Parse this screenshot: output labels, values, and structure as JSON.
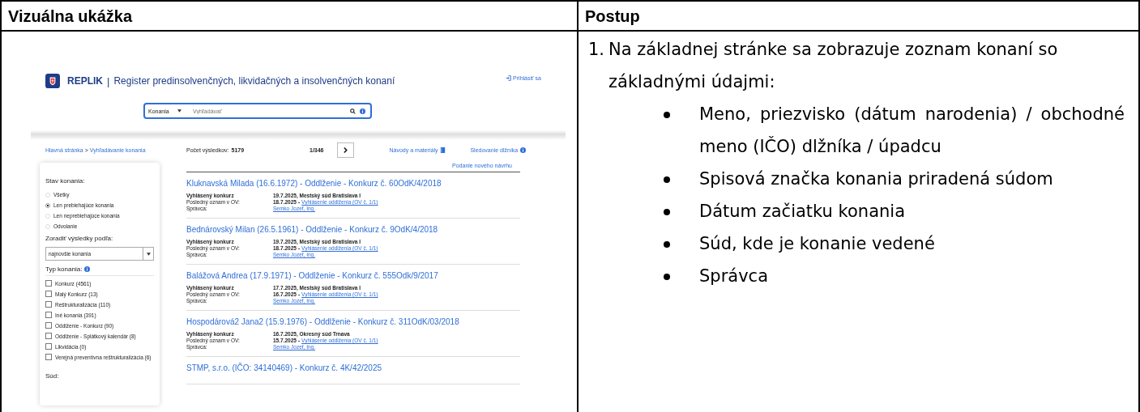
{
  "table": {
    "columns": [
      "Vizuálna ukážka",
      "Postup"
    ]
  },
  "screenshot": {
    "logo_text": "REPLIK",
    "title_separator": "|",
    "site_title": "Register predinsolvenčných, likvidačných a insolvenčných konaní",
    "login": "Prihlásiť sa",
    "search": {
      "category": "Konania",
      "placeholder": "Vyhľadávať"
    },
    "breadcrumb": [
      "Hlavná stránka",
      "Vyhľadávanie konania"
    ],
    "breadcrumb_separator": ">",
    "result_count_label": "Počet výsledkov:",
    "result_count": "5179",
    "page": "1/346",
    "links": [
      "Návody a materiály",
      "Sledovanie dlžníka"
    ],
    "new_proposal": "Podanie nového návrhu",
    "filters": {
      "status_title": "Stav konania:",
      "status_options": [
        {
          "label": "Všetky",
          "selected": false
        },
        {
          "label": "Len prebiehajúce konania",
          "selected": true
        },
        {
          "label": "Len neprebiehajúce konania",
          "selected": false
        },
        {
          "label": "Odvolanie",
          "selected": false
        }
      ],
      "sort_title": "Zoradiť výsledky podľa:",
      "sort_value": "najnovšie konania",
      "type_title": "Typ konania:",
      "types": [
        {
          "label": "Konkurz (4561)",
          "checked": false
        },
        {
          "label": "Malý Konkurz (13)",
          "checked": false
        },
        {
          "label": "Reštrukturalizácia (110)",
          "checked": false
        },
        {
          "label": "Iné konania (391)",
          "checked": false
        },
        {
          "label": "Oddlženie - Konkurz (90)",
          "checked": false
        },
        {
          "label": "Oddlženie - Splátkový kalendár (8)",
          "checked": false
        },
        {
          "label": "Likvidácia (0)",
          "checked": false
        },
        {
          "label": "Verejná preventívna reštrukturalizácia (6)",
          "checked": false
        }
      ],
      "court_title": "Súd:"
    },
    "results": [
      {
        "title": "Kluknavská Milada (16.6.1972) - Oddlženie - Konkurz č. 60OdK/4/2018",
        "declared_label": "Vyhlásený konkurz",
        "declared_value": "19.7.2025, Mestský súd Bratislava I",
        "notice_label": "Posledný oznam v OV:",
        "notice_date": "18.7.2025",
        "notice_separator": "-",
        "notice_link": "Vyhlásenie oddlženia (OV č. 1/1)",
        "admin_label": "Správca:",
        "admin_link": "Semko Jozef, Ing."
      },
      {
        "title": "Bednárovský Milan (26.5.1961) - Oddlženie - Konkurz č. 9OdK/4/2018",
        "declared_label": "Vyhlásený konkurz",
        "declared_value": "19.7.2025, Mestský súd Bratislava I",
        "notice_label": "Posledný oznam v OV:",
        "notice_date": "18.7.2025",
        "notice_separator": "-",
        "notice_link": "Vyhlásenie oddlženia (OV č. 1/1)",
        "admin_label": "Správca:",
        "admin_link": "Semko Jozef, Ing."
      },
      {
        "title": "Balážová Andrea (17.9.1971) - Oddlženie - Konkurz č. 555Odk/9/2017",
        "declared_label": "Vyhlásený konkurz",
        "declared_value": "17.7.2025, Mestský súd Bratislava I",
        "notice_label": "Posledný oznam v OV:",
        "notice_date": "16.7.2025",
        "notice_separator": "-",
        "notice_link": "Vyhlásenie oddlženia (OV č. 1/1)",
        "admin_label": "Správca:",
        "admin_link": "Semko Jozef, Ing."
      },
      {
        "title": "Hospodárová2 Jana2 (15.9.1976) - Oddlženie - Konkurz č. 311OdK/03/2018",
        "declared_label": "Vyhlásený konkurz",
        "declared_value": "16.7.2025, Okresný súd Trnava",
        "notice_label": "Posledný oznam v OV:",
        "notice_date": "15.7.2025",
        "notice_separator": "-",
        "notice_link": "Vyhlásenie oddlženia (OV č. 1/1)",
        "admin_label": "Správca:",
        "admin_link": "Semko Jozef, Ing."
      },
      {
        "title": "STMP, s.r.o. (IČO: 34140469) - Konkurz č. 4K/42/2025"
      }
    ]
  },
  "procedure": {
    "steps": [
      {
        "number": "1.",
        "text": "Na základnej stránke sa zobrazuje zoznam konaní so základnými údajmi:",
        "bullets": [
          "Meno, priezvisko (dátum narodenia) / obchodné meno (IČO) dlžníka / úpadcu",
          "Spisová značka konania priradená súdom",
          "Dátum začiatku konania",
          "Súd, kde je konanie vedené",
          "Správca"
        ]
      }
    ]
  }
}
